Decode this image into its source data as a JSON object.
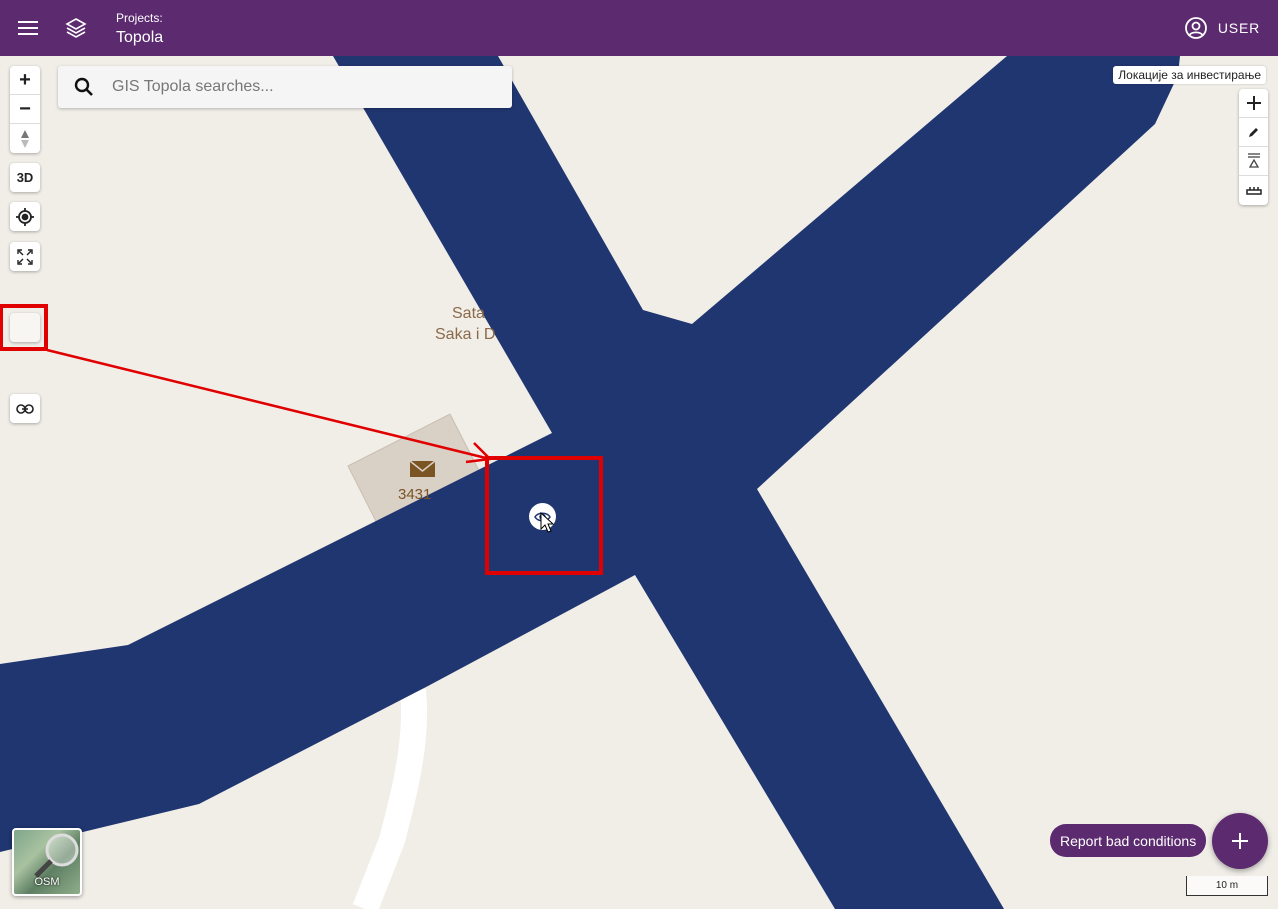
{
  "appbar": {
    "project_caption": "Projects:",
    "project_name": "Topola",
    "user_label": "USER"
  },
  "icons": {
    "menu": "hamburger-icon",
    "layers": "layers-icon",
    "user": "account-circle-icon",
    "search": "magnifier-icon",
    "link": "link-icon",
    "locate": "crosshair-icon",
    "fullscreen": "expand-icon",
    "compass": "compass-icon",
    "add": "plus-icon",
    "draw": "pencil-icon",
    "profile": "elevation-icon",
    "measure": "ruler-icon",
    "marker": "eye-icon"
  },
  "search": {
    "placeholder": "GIS Topola searches..."
  },
  "left_toolbar": {
    "zoom_in": "+",
    "zoom_out": "−",
    "three_d": "3D"
  },
  "map": {
    "active_layer_label": "Локације за инвестирање",
    "poi_label_1": "Sata",
    "poi_label_2": "Saka i D",
    "house_number": "3431",
    "scale_label": "10 m"
  },
  "basemap": {
    "label": "OSM"
  },
  "report_button": {
    "label": "Report bad conditions"
  },
  "colors": {
    "appbar": "#5c2a6f",
    "road": "#203670",
    "map_background": "#f1eee8",
    "annotation": "#e00000"
  }
}
